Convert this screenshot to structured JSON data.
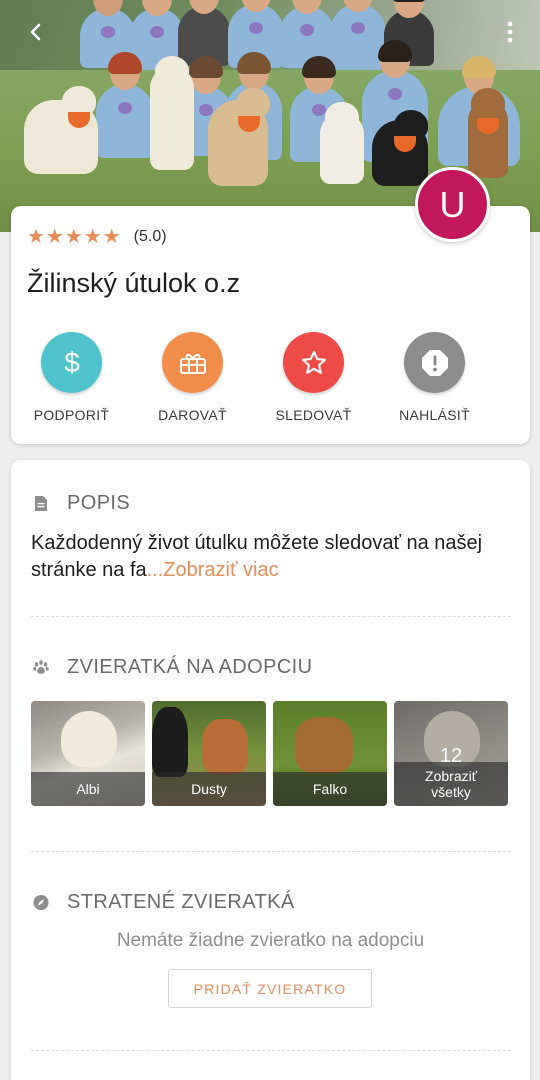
{
  "header": {
    "back_icon": "arrow-back-icon",
    "more_icon": "more-vert-icon",
    "avatar_letter": "U",
    "avatar_color": "#c2185b"
  },
  "shelter": {
    "rating_stars": "★★★★★",
    "rating_value": "(5.0)",
    "name": "Žilinský útulok o.z"
  },
  "actions": [
    {
      "label": "PODPORIŤ",
      "icon": "dollar-icon",
      "color": "#4ec3cc"
    },
    {
      "label": "DAROVAŤ",
      "icon": "gift-icon",
      "color": "#f28c4a"
    },
    {
      "label": "SLEDOVAŤ",
      "icon": "star-icon",
      "color": "#ee4b47"
    },
    {
      "label": "NAHLÁSIŤ",
      "icon": "report-icon",
      "color": "#8c8c8c"
    }
  ],
  "description": {
    "heading": "POPIS",
    "text": "Každodenný život útulku môžete sledovať na našej stránke na fa",
    "more_link": "...Zobraziť viac"
  },
  "adoption": {
    "heading": "ZVIERATKÁ NA ADOPCIU",
    "pets": [
      {
        "name": "Albi"
      },
      {
        "name": "Dusty"
      },
      {
        "name": "Falko"
      }
    ],
    "show_all_count": "12",
    "show_all_label_line1": "Zobraziť",
    "show_all_label_line2": "všetky"
  },
  "lost": {
    "heading": "STRATENÉ ZVIERATKÁ",
    "empty_text": "Nemáte žiadne zvieratko na adopciu",
    "add_button": "PRIDAŤ ZVIERATKO"
  },
  "colors": {
    "accent": "#e88c58"
  }
}
